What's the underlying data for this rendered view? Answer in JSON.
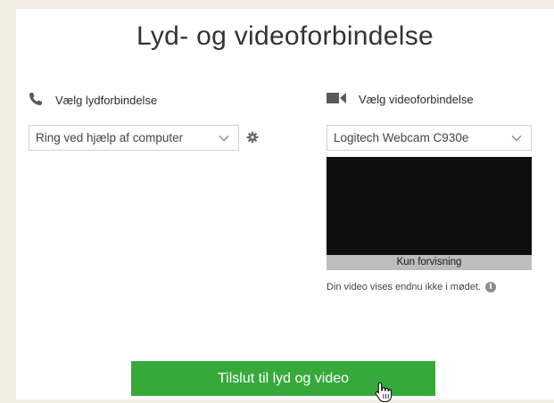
{
  "title": "Lyd- og videoforbindelse",
  "audio": {
    "heading": "Vælg lydforbindelse",
    "icon": "phone-icon",
    "selected": "Ring ved hjælp af computer"
  },
  "video": {
    "heading": "Vælg videoforbindelse",
    "icon": "video-camera-icon",
    "selected": "Logitech Webcam C930e",
    "preview_label": "Kun forvisning",
    "note": "Din video vises endnu ikke i mødet."
  },
  "join_button": "Tilslut til lyd og video",
  "colors": {
    "background": "#f3ece3",
    "panel": "#ffffff",
    "accent_green": "#36a93a",
    "preview": "#0e0e0e"
  }
}
